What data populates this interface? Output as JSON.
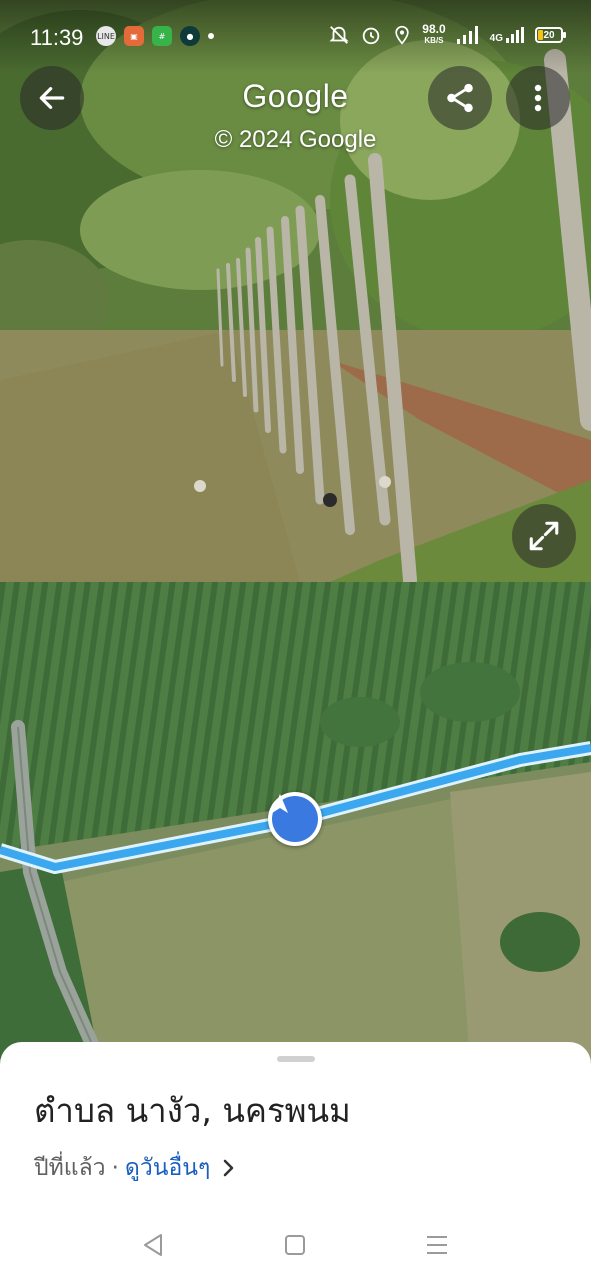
{
  "status_bar": {
    "time": "11:39",
    "network_speed": "98.0",
    "network_unit": "KB/S",
    "signal_label": "4G",
    "battery_level": "20",
    "app_icons": [
      "line-icon",
      "game-icon",
      "calculator-icon",
      "chat-icon"
    ]
  },
  "header": {
    "title": "Google",
    "copyright": "© 2024 Google",
    "back_icon": "arrow-left-icon",
    "share_icon": "share-icon",
    "more_icon": "more-vert-icon"
  },
  "street_view": {
    "expand_icon": "expand-icon"
  },
  "map": {
    "route_color": "#3aa7ee",
    "marker_color": "#3a7ae0",
    "marker_icon": "navigation-arrow-icon"
  },
  "place": {
    "title": "ตำบล นางัว, นครพนม",
    "date_label": "ปีที่แล้ว",
    "separator": "·",
    "more_dates_link": "ดูวันอื่นๆ",
    "chevron_icon": "chevron-right-icon"
  },
  "system_nav": {
    "back_icon": "triangle-back-icon",
    "home_icon": "square-home-icon",
    "menu_icon": "menu-lines-icon"
  },
  "colors": {
    "link": "#1a5fbf",
    "title_text": "#222222"
  }
}
